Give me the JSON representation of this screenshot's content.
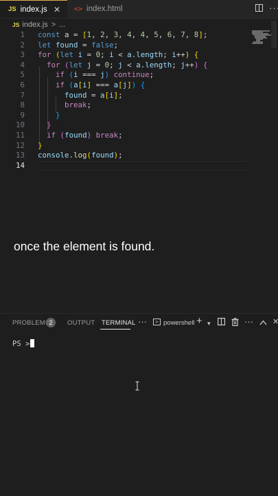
{
  "tabs": [
    {
      "label": "index.js",
      "icon": "js-file-icon",
      "active": true
    },
    {
      "label": "index.html",
      "icon": "html-file-icon",
      "active": false
    }
  ],
  "tab_js_badge": "JS",
  "breadcrumb": {
    "badge": "JS",
    "file": "index.js",
    "separator": ">",
    "more": "..."
  },
  "editor": {
    "current_line": 14,
    "line_numbers": [
      "1",
      "2",
      "3",
      "4",
      "5",
      "6",
      "7",
      "8",
      "9",
      "10",
      "11",
      "12",
      "13",
      "14"
    ]
  },
  "caption": "once the element is found.",
  "panel": {
    "tabs": [
      "PROBLEMS",
      "OUTPUT",
      "TERMINAL"
    ],
    "active_tab": "TERMINAL",
    "problems_count": "2",
    "shell": "powershell",
    "prompt": "PS >"
  },
  "colors": {
    "keyword": "#569cd6",
    "control": "#c586c0",
    "variable": "#9cdcfe",
    "number": "#b5cea8",
    "function": "#dcdcaa"
  }
}
